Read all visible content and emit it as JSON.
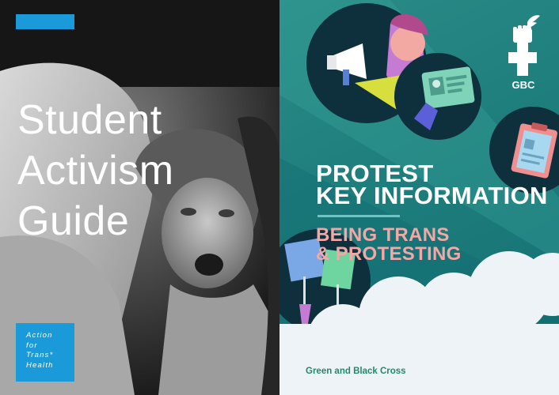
{
  "left_cover": {
    "title_lines": [
      "Student",
      "Activism",
      "Guide"
    ],
    "badge_lines": [
      "Action",
      "for",
      "Trans*",
      "Health"
    ],
    "accent_color": "#1a9ad8",
    "photo": "black-and-white protest photo of a person shouting"
  },
  "right_cover": {
    "logo_text": "GBC",
    "heading_lines": [
      "PROTEST",
      "KEY INFORMATION"
    ],
    "subheading_lines": [
      "BEING TRANS",
      "& PROTESTING"
    ],
    "publisher": "Green and Black Cross",
    "colors": {
      "background": "#1f7f7d",
      "heading": "#ffffff",
      "subheading": "#f3a7a7",
      "publisher": "#1f8b6a"
    },
    "icons": [
      "megaphone-icon",
      "id-card-icon",
      "clipboard-icon",
      "protest-placard-icon",
      "fist-venus-logo-icon"
    ]
  }
}
